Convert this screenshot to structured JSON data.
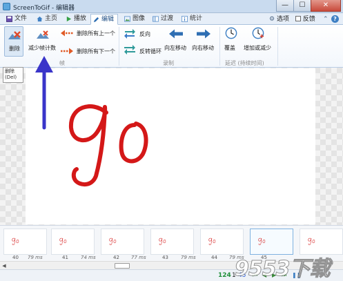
{
  "window": {
    "title": "ScreenToGif - 编辑器",
    "minimize_glyph": "—",
    "maximize_glyph": "☐",
    "close_glyph": "✕"
  },
  "menu": {
    "tabs": [
      {
        "label": "文件",
        "icon": "save-icon"
      },
      {
        "label": "主页",
        "icon": "home-icon"
      },
      {
        "label": "播放",
        "icon": "play-icon"
      },
      {
        "label": "编辑",
        "icon": "edit-pencil-icon",
        "active": true
      },
      {
        "label": "图像",
        "icon": "image-icon"
      },
      {
        "label": "过渡",
        "icon": "transition-icon"
      },
      {
        "label": "统计",
        "icon": "statistics-icon"
      }
    ],
    "options_label": "选项",
    "feedback_label": "反馈"
  },
  "ribbon": {
    "frames_group": {
      "label": "帧",
      "delete_label": "删除",
      "reduce_count_label": "减少帧计数",
      "delete_all_previous_label": "删除所有上一个",
      "delete_all_next_label": "删除所有下一个"
    },
    "record_group": {
      "label": "录制",
      "reverse_label": "反向",
      "yoyo_label": "反转循环",
      "move_left_label": "向左移动",
      "move_right_label": "向右移动"
    },
    "delay_group": {
      "label": "延迟 (持续时间)",
      "override_label": "覆盖",
      "increase_decrease_label": "增加或减少"
    }
  },
  "tooltip": {
    "line1": "删除",
    "line2": "(Del)"
  },
  "canvas": {
    "drawing_text": "go",
    "ink_color": "#d41818"
  },
  "annotation": {
    "arrow_color": "#3a35c9"
  },
  "thumbnails": [
    {
      "number": "40",
      "delay": "79 ms"
    },
    {
      "number": "41",
      "delay": "74 ms"
    },
    {
      "number": "42",
      "delay": "77 ms"
    },
    {
      "number": "43",
      "delay": "79 ms"
    },
    {
      "number": "44",
      "delay": "79 ms"
    },
    {
      "number": "45",
      "delay": "",
      "selected": true
    },
    {
      "number": "",
      "delay": ""
    }
  ],
  "status": {
    "current_frame": "124",
    "selected_count": "1",
    "total_frames": "45"
  },
  "colors": {
    "accent": "#2f6fb3",
    "ribbon_border": "#b8cce4"
  },
  "watermark": {
    "text": "9553下载"
  }
}
